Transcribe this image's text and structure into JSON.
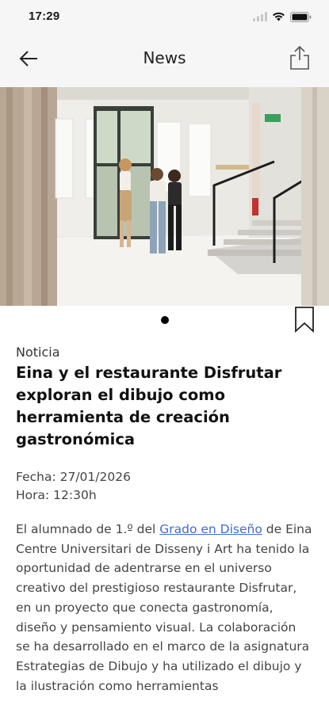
{
  "status_bar": {
    "time": "17:29"
  },
  "nav": {
    "title": "News"
  },
  "hero_image": {
    "alt": "Estudiantes observando ilustraciones colgadas en una sala blanca con escalera"
  },
  "article": {
    "category": "Noticia",
    "title": "Eina y el restaurante Disfrutar exploran el dibujo como herramienta de creación gastronómica",
    "date_label": "Fecha: 27/01/2026",
    "time_label": "Hora: 12:30h",
    "body_prefix": "El alumnado de 1.º del ",
    "body_link": "Grado en Diseño",
    "body_suffix": " de Eina Centre Universitari de Disseny i Art ha tenido la oportunidad de adentrarse en el universo creativo del prestigioso restaurante Disfrutar, en un proyecto que conecta gastronomía, diseño y pensamiento visual. La colaboración se ha desarrollado en el marco de la asignatura Estrategias de Dibujo y ha utilizado el dibujo y la ilustración como herramientas"
  },
  "colors": {
    "link": "#3b6fd1",
    "bar_bg": "#f6f6f6",
    "text": "#444444"
  },
  "icons": {
    "back": "arrow-left-icon",
    "share": "share-icon",
    "bookmark": "bookmark-icon"
  }
}
